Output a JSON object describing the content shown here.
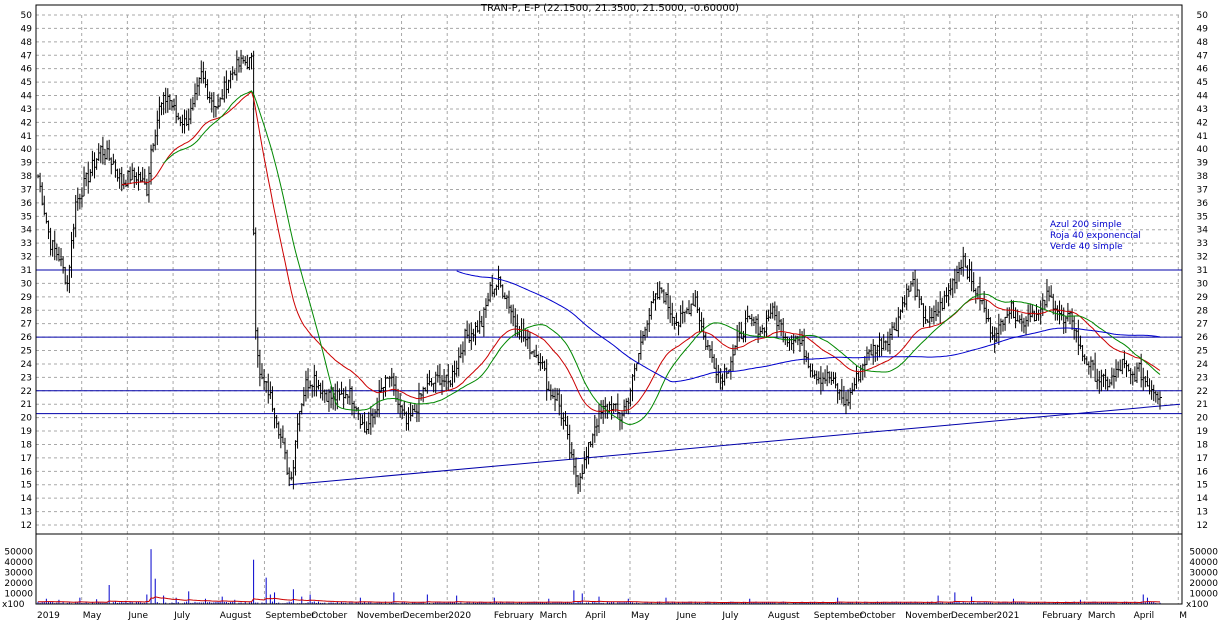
{
  "chart_data": {
    "type": "ohlc",
    "title": "TRAN-P, E-P (22.1500, 21.3500, 21.5000, -0.60000)",
    "price_axis": {
      "ylim": [
        12,
        50
      ],
      "ticks": [
        "12",
        "13",
        "14",
        "15",
        "16",
        "17",
        "18",
        "19",
        "20",
        "21",
        "22",
        "23",
        "24",
        "25",
        "26",
        "27",
        "28",
        "29",
        "30",
        "31",
        "32",
        "33",
        "34",
        "35",
        "36",
        "37",
        "38",
        "39",
        "40",
        "41",
        "42",
        "43",
        "44",
        "45",
        "46",
        "47",
        "48",
        "49",
        "50"
      ],
      "both_sides": true,
      "grid": true,
      "grid_style": "dashed"
    },
    "volume_axis": {
      "ticks": [
        "10000",
        "20000",
        "30000",
        "40000",
        "50000"
      ],
      "unit_label": "x100"
    },
    "x_labels": [
      "2019",
      "May",
      "June",
      "July",
      "August",
      "September",
      "October",
      "November",
      "December",
      "2020",
      "February",
      "March",
      "April",
      "May",
      "June",
      "July",
      "August",
      "September",
      "October",
      "November",
      "December",
      "2021",
      "February",
      "March",
      "April",
      "M"
    ],
    "legend": [
      {
        "label": "Azul 200 simple",
        "color": "#0000cc"
      },
      {
        "label": "Roja 40 exponencial",
        "color": "#0000cc"
      },
      {
        "label": "Verde 40 simple",
        "color": "#0000cc"
      }
    ],
    "horizontal_lines": [
      {
        "value": 31,
        "color": "#0000aa"
      },
      {
        "value": 26,
        "color": "#0000aa"
      },
      {
        "value": 22,
        "color": "#0000aa"
      },
      {
        "value": 20.3,
        "color": "#0000aa"
      }
    ],
    "trendline": {
      "points": [
        {
          "period": "August 2019",
          "value": 15
        },
        {
          "period": "April 2021",
          "value": 21
        }
      ],
      "color": "#0000aa"
    },
    "price_anchors": [
      [
        0,
        38
      ],
      [
        6,
        33
      ],
      [
        10,
        32
      ],
      [
        14,
        30
      ],
      [
        18,
        36
      ],
      [
        24,
        38
      ],
      [
        30,
        40
      ],
      [
        36,
        39
      ],
      [
        40,
        37.5
      ],
      [
        44,
        38
      ],
      [
        48,
        38
      ],
      [
        52,
        37
      ],
      [
        54,
        40
      ],
      [
        58,
        43
      ],
      [
        62,
        44
      ],
      [
        66,
        42.5
      ],
      [
        70,
        42
      ],
      [
        74,
        43
      ],
      [
        78,
        45.5
      ],
      [
        82,
        44
      ],
      [
        86,
        43
      ],
      [
        90,
        45
      ],
      [
        94,
        46
      ],
      [
        98,
        46.5
      ],
      [
        102,
        46.5
      ],
      [
        103,
        34
      ],
      [
        104,
        27
      ],
      [
        106,
        23
      ],
      [
        110,
        22
      ],
      [
        114,
        20
      ],
      [
        118,
        17
      ],
      [
        120,
        15.5
      ],
      [
        122,
        16.5
      ],
      [
        124,
        20
      ],
      [
        128,
        22.5
      ],
      [
        132,
        23
      ],
      [
        136,
        22
      ],
      [
        140,
        21.5
      ],
      [
        144,
        21.5
      ],
      [
        148,
        22
      ],
      [
        152,
        21
      ],
      [
        156,
        19
      ],
      [
        160,
        20
      ],
      [
        164,
        22
      ],
      [
        168,
        23
      ],
      [
        172,
        21
      ],
      [
        176,
        19.5
      ],
      [
        180,
        20.5
      ],
      [
        184,
        22
      ],
      [
        188,
        22.5
      ],
      [
        192,
        23
      ],
      [
        196,
        22.5
      ],
      [
        200,
        24
      ],
      [
        204,
        26
      ],
      [
        208,
        26.5
      ],
      [
        212,
        27
      ],
      [
        216,
        29.5
      ],
      [
        220,
        30
      ],
      [
        224,
        29
      ],
      [
        228,
        27
      ],
      [
        232,
        26
      ],
      [
        236,
        25
      ],
      [
        240,
        24.5
      ],
      [
        244,
        22
      ],
      [
        248,
        21.5
      ],
      [
        252,
        19
      ],
      [
        256,
        16
      ],
      [
        258,
        15.5
      ],
      [
        262,
        17
      ],
      [
        266,
        19.5
      ],
      [
        270,
        20.5
      ],
      [
        274,
        21
      ],
      [
        278,
        20
      ],
      [
        282,
        21.5
      ],
      [
        286,
        24
      ],
      [
        290,
        27
      ],
      [
        294,
        28.5
      ],
      [
        298,
        29.5
      ],
      [
        302,
        28
      ],
      [
        306,
        27
      ],
      [
        310,
        28
      ],
      [
        314,
        29
      ],
      [
        318,
        26
      ],
      [
        322,
        24.5
      ],
      [
        326,
        23
      ],
      [
        330,
        24
      ],
      [
        334,
        25.5
      ],
      [
        338,
        27
      ],
      [
        342,
        27
      ],
      [
        346,
        26.5
      ],
      [
        350,
        28
      ],
      [
        354,
        27
      ],
      [
        358,
        26
      ],
      [
        362,
        26
      ],
      [
        366,
        25
      ],
      [
        370,
        23.5
      ],
      [
        374,
        23
      ],
      [
        378,
        23
      ],
      [
        382,
        22
      ],
      [
        386,
        21
      ],
      [
        390,
        22.5
      ],
      [
        394,
        24
      ],
      [
        398,
        25
      ],
      [
        402,
        25.5
      ],
      [
        406,
        26
      ],
      [
        410,
        27
      ],
      [
        414,
        29
      ],
      [
        418,
        30
      ],
      [
        422,
        28
      ],
      [
        426,
        27
      ],
      [
        430,
        28
      ],
      [
        434,
        29
      ],
      [
        438,
        30.5
      ],
      [
        442,
        32
      ],
      [
        446,
        30
      ],
      [
        450,
        29
      ],
      [
        454,
        27
      ],
      [
        458,
        26
      ],
      [
        462,
        28
      ],
      [
        466,
        28
      ],
      [
        470,
        27
      ],
      [
        474,
        28
      ],
      [
        478,
        27.5
      ],
      [
        482,
        29
      ],
      [
        486,
        28.5
      ],
      [
        490,
        27
      ],
      [
        494,
        27.5
      ],
      [
        498,
        25
      ],
      [
        502,
        24
      ],
      [
        506,
        23
      ],
      [
        510,
        22.5
      ],
      [
        514,
        23
      ],
      [
        518,
        24
      ],
      [
        522,
        23
      ],
      [
        526,
        23.5
      ],
      [
        530,
        22.5
      ],
      [
        534,
        22
      ],
      [
        536,
        21.5
      ]
    ],
    "price_range_scale": 0.65,
    "moving_averages": [
      {
        "period": 40,
        "kind": "exponential",
        "color": "#cc0000",
        "from_bar": 40
      },
      {
        "period": 40,
        "kind": "simple",
        "color": "#008800",
        "from_bar": 60
      },
      {
        "period": 200,
        "kind": "simple",
        "color": "#0000cc",
        "from_bar": 200
      }
    ],
    "volume": {
      "baseline": 1200,
      "spikes": [
        [
          103,
          42000
        ],
        [
          109,
          25000
        ],
        [
          111,
          9000
        ],
        [
          113,
          11000
        ],
        [
          122,
          14000
        ],
        [
          126,
          7000
        ],
        [
          130,
          9000
        ],
        [
          154,
          6000
        ],
        [
          170,
          11000
        ],
        [
          186,
          9000
        ],
        [
          200,
          8000
        ],
        [
          218,
          6000
        ],
        [
          244,
          5000
        ],
        [
          256,
          13000
        ],
        [
          260,
          10000
        ],
        [
          268,
          7000
        ],
        [
          282,
          5000
        ],
        [
          300,
          6000
        ],
        [
          340,
          5000
        ],
        [
          382,
          6000
        ],
        [
          430,
          8000
        ],
        [
          438,
          11000
        ],
        [
          446,
          7000
        ],
        [
          466,
          5000
        ],
        [
          498,
          4000
        ],
        [
          528,
          9000
        ],
        [
          530,
          6000
        ]
      ],
      "early_spikes": [
        [
          4,
          5000
        ],
        [
          10,
          4000
        ],
        [
          20,
          6000
        ],
        [
          28,
          4500
        ],
        [
          34,
          18000
        ],
        [
          42,
          3000
        ],
        [
          52,
          9000
        ],
        [
          54,
          52000
        ],
        [
          56,
          24000
        ],
        [
          60,
          8000
        ],
        [
          66,
          6000
        ],
        [
          72,
          12000
        ],
        [
          80,
          5000
        ],
        [
          88,
          7000
        ],
        [
          94,
          4000
        ]
      ]
    }
  }
}
